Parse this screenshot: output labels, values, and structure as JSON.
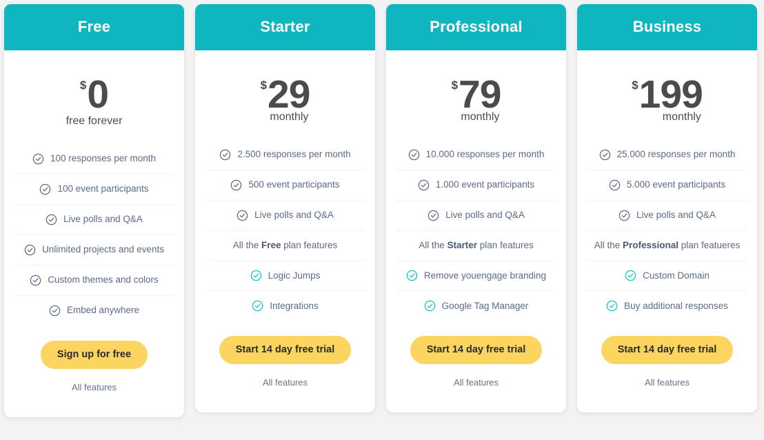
{
  "colors": {
    "header_teal": "#0fb6c0",
    "cta_yellow": "#fcd460",
    "check_slate": "#5b6b85",
    "check_teal": "#14c2cc",
    "text_slate": "#5b6b85",
    "price_gray": "#4b4b4b",
    "page_background": "#f3f3f4",
    "card_background": "#ffffff"
  },
  "plans": [
    {
      "name": "Free",
      "currency": "$",
      "amount": "0",
      "period": "free forever",
      "period_centered": true,
      "features": [
        {
          "text": "100 responses per month",
          "icon": "check-circle-icon",
          "icon_color": "slate",
          "has_icon": true,
          "bold_part": ""
        },
        {
          "text": "100 event participants",
          "icon": "check-circle-icon",
          "icon_color": "slate",
          "has_icon": true,
          "bold_part": ""
        },
        {
          "text": "Live polls and Q&A",
          "icon": "check-circle-icon",
          "icon_color": "slate",
          "has_icon": true,
          "bold_part": ""
        },
        {
          "text": "Unlimited projects and events",
          "icon": "check-circle-icon",
          "icon_color": "slate",
          "has_icon": true,
          "bold_part": ""
        },
        {
          "text": "Custom themes and colors",
          "icon": "check-circle-icon",
          "icon_color": "slate",
          "has_icon": true,
          "bold_part": ""
        },
        {
          "text": "Embed anywhere",
          "icon": "check-circle-icon",
          "icon_color": "slate",
          "has_icon": true,
          "bold_part": ""
        }
      ],
      "cta_label": "Sign up for free",
      "all_features_label": "All features"
    },
    {
      "name": "Starter",
      "currency": "$",
      "amount": "29",
      "period": "monthly",
      "period_centered": false,
      "features": [
        {
          "text": "2.500 responses per month",
          "icon": "check-circle-icon",
          "icon_color": "slate",
          "has_icon": true,
          "bold_part": ""
        },
        {
          "text": "500 event participants",
          "icon": "check-circle-icon",
          "icon_color": "slate",
          "has_icon": true,
          "bold_part": ""
        },
        {
          "text": "Live polls and Q&A",
          "icon": "check-circle-icon",
          "icon_color": "slate",
          "has_icon": true,
          "bold_part": ""
        },
        {
          "text": "All the Free plan features",
          "icon": "",
          "icon_color": "",
          "has_icon": false,
          "bold_part": "Free"
        },
        {
          "text": "Logic Jumps",
          "icon": "check-circle-icon",
          "icon_color": "teal",
          "has_icon": true,
          "bold_part": ""
        },
        {
          "text": "Integrations",
          "icon": "check-circle-icon",
          "icon_color": "teal",
          "has_icon": true,
          "bold_part": ""
        }
      ],
      "cta_label": "Start 14 day free trial",
      "all_features_label": "All features"
    },
    {
      "name": "Professional",
      "currency": "$",
      "amount": "79",
      "period": "monthly",
      "period_centered": false,
      "features": [
        {
          "text": "10.000 responses per month",
          "icon": "check-circle-icon",
          "icon_color": "slate",
          "has_icon": true,
          "bold_part": ""
        },
        {
          "text": "1.000 event participants",
          "icon": "check-circle-icon",
          "icon_color": "slate",
          "has_icon": true,
          "bold_part": ""
        },
        {
          "text": "Live polls and Q&A",
          "icon": "check-circle-icon",
          "icon_color": "slate",
          "has_icon": true,
          "bold_part": ""
        },
        {
          "text": "All the Starter plan features",
          "icon": "",
          "icon_color": "",
          "has_icon": false,
          "bold_part": "Starter"
        },
        {
          "text": "Remove youengage branding",
          "icon": "check-circle-icon",
          "icon_color": "teal",
          "has_icon": true,
          "bold_part": ""
        },
        {
          "text": "Google Tag Manager",
          "icon": "check-circle-icon",
          "icon_color": "teal",
          "has_icon": true,
          "bold_part": ""
        }
      ],
      "cta_label": "Start 14 day free trial",
      "all_features_label": "All features"
    },
    {
      "name": "Business",
      "currency": "$",
      "amount": "199",
      "period": "monthly",
      "period_centered": false,
      "features": [
        {
          "text": "25.000 responses per month",
          "icon": "check-circle-icon",
          "icon_color": "slate",
          "has_icon": true,
          "bold_part": ""
        },
        {
          "text": "5.000 event participants",
          "icon": "check-circle-icon",
          "icon_color": "slate",
          "has_icon": true,
          "bold_part": ""
        },
        {
          "text": "Live polls and Q&A",
          "icon": "check-circle-icon",
          "icon_color": "slate",
          "has_icon": true,
          "bold_part": ""
        },
        {
          "text": "All the Professional plan featueres",
          "icon": "",
          "icon_color": "",
          "has_icon": false,
          "bold_part": "Professional"
        },
        {
          "text": "Custom Domain",
          "icon": "check-circle-icon",
          "icon_color": "teal",
          "has_icon": true,
          "bold_part": ""
        },
        {
          "text": "Buy additional responses",
          "icon": "check-circle-icon",
          "icon_color": "teal",
          "has_icon": true,
          "bold_part": ""
        }
      ],
      "cta_label": "Start 14 day free trial",
      "all_features_label": "All features"
    }
  ]
}
